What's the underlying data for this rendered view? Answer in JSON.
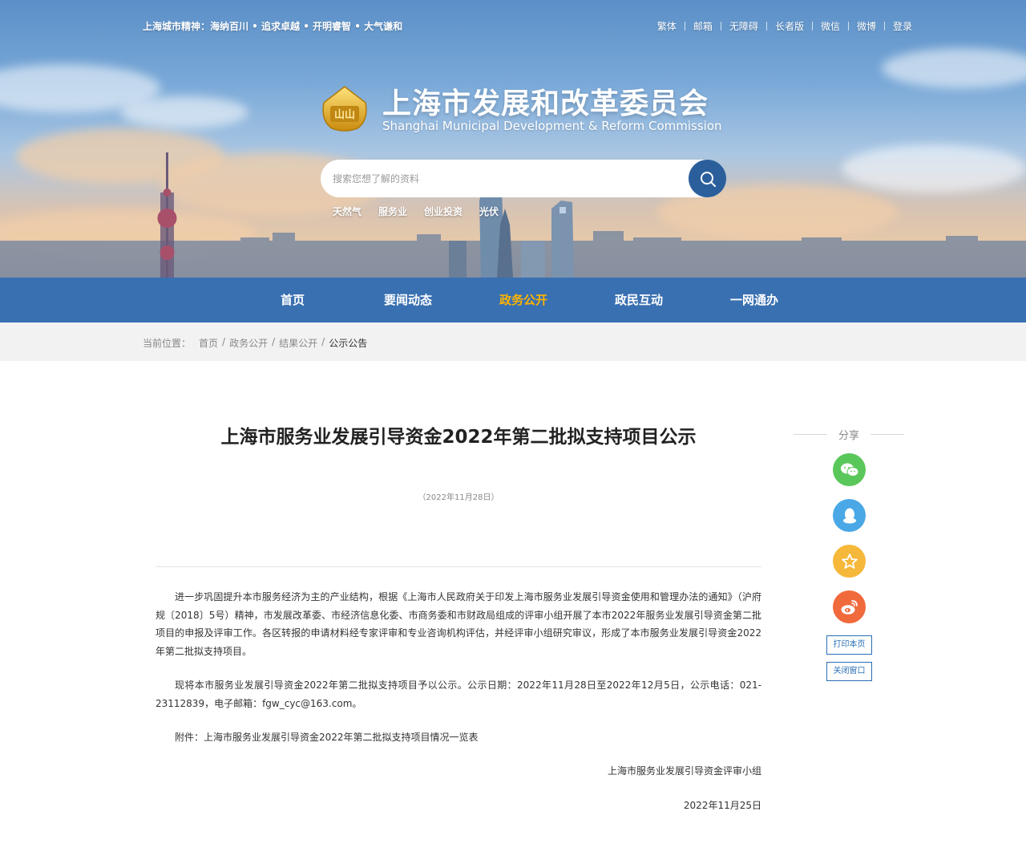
{
  "header": {
    "slogan": "上海城市精神：海纳百川 • 追求卓越 • 开明睿智 • 大气谦和",
    "top_links": [
      "繁体",
      "邮箱",
      "无障碍",
      "长者版",
      "微信",
      "微博",
      "登录"
    ],
    "emblem_text": "山山",
    "site_title_cn": "上海市发展和改革委员会",
    "site_title_en": "Shanghai Municipal Development & Reform Commission",
    "search": {
      "placeholder": "搜索您想了解的资料",
      "icon": "search-icon"
    },
    "hot_words": [
      "天然气",
      "服务业",
      "创业投资",
      "光伏"
    ]
  },
  "nav": {
    "items": [
      "首页",
      "要闻动态",
      "政务公开",
      "政民互动",
      "一网通办"
    ],
    "active_index": 2,
    "active_color": "#ffb400"
  },
  "breadcrumb": {
    "label": "当前位置：",
    "links": [
      "首页",
      "政务公开",
      "结果公开"
    ],
    "current": "公示公告"
  },
  "article": {
    "title": "上海市服务业发展引导资金2022年第二批拟支持项目公示",
    "date": "（2022年11月28日）",
    "paragraphs": [
      "进一步巩固提升本市服务经济为主的产业结构，根据《上海市人民政府关于印发上海市服务业发展引导资金使用和管理办法的通知》（沪府规〔2018〕5号）精神，市发展改革委、市经济信息化委、市商务委和市财政局组成的评审小组开展了本市2022年服务业发展引导资金第二批项目的申报及评审工作。各区转报的申请材料经专家评审和专业咨询机构评估，并经评审小组研究审议，形成了本市服务业发展引导资金2022年第二批拟支持项目。",
      "现将本市服务业发展引导资金2022年第二批拟支持项目予以公示。公示日期：2022年11月28日至2022年12月5日，公示电话：021-23112839，电子邮箱：fgw_cyc@163.com。",
      "附件：上海市服务业发展引导资金2022年第二批拟支持项目情况一览表"
    ],
    "sign_org": "上海市服务业发展引导资金评审小组",
    "sign_date": "2022年11月25日"
  },
  "share": {
    "label": "分享",
    "icons": [
      {
        "name": "wechat-icon",
        "color": "#5ac75a"
      },
      {
        "name": "qq-icon",
        "color": "#4aa8e6"
      },
      {
        "name": "favorite-star-icon",
        "color": "#f6b83a"
      },
      {
        "name": "weibo-icon",
        "color": "#f06a3c"
      }
    ],
    "print_label": "打印本页",
    "close_label": "关闭窗口"
  }
}
